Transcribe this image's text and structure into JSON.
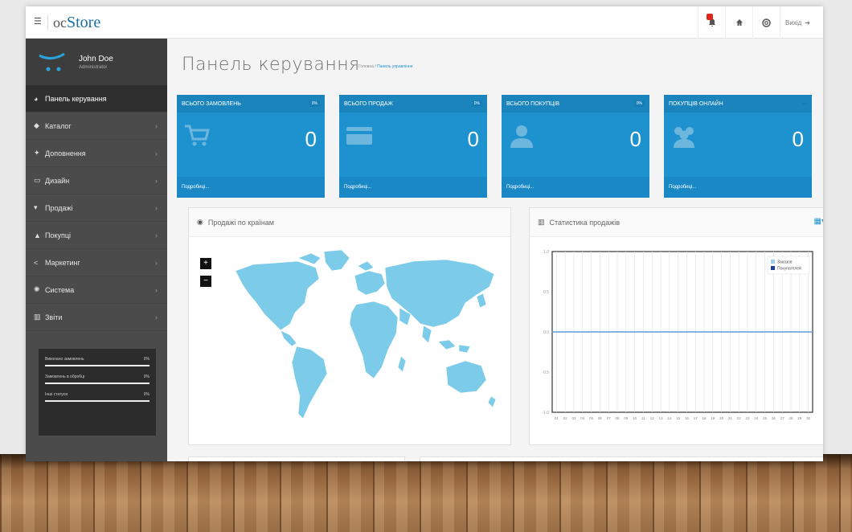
{
  "header": {
    "logo_prefix": "oc",
    "logo_main": "Store",
    "logout": "Вихід"
  },
  "profile": {
    "name": "John Doe",
    "role": "Administrator"
  },
  "sidebar": {
    "items": [
      {
        "label": "Панель керування",
        "icon": "dashboard-icon"
      },
      {
        "label": "Каталог",
        "icon": "tag-icon"
      },
      {
        "label": "Доповнення",
        "icon": "puzzle-icon"
      },
      {
        "label": "Дизайн",
        "icon": "monitor-icon"
      },
      {
        "label": "Продажі",
        "icon": "cart-icon"
      },
      {
        "label": "Покупці",
        "icon": "user-icon"
      },
      {
        "label": "Маркетинг",
        "icon": "share-icon"
      },
      {
        "label": "Система",
        "icon": "gear-icon"
      },
      {
        "label": "Звіти",
        "icon": "bar-chart-icon"
      }
    ],
    "progress": [
      {
        "label": "Виконано замовлень",
        "value": "0%"
      },
      {
        "label": "Замовлень в обробці",
        "value": "0%"
      },
      {
        "label": "Інші статуси",
        "value": "0%"
      }
    ]
  },
  "page": {
    "title": "Панель керування",
    "crumb_home": "Головна",
    "crumb_sep": " / ",
    "crumb_current": "Панель управління"
  },
  "tiles": [
    {
      "title": "ВСЬОГО ЗАМОВЛЕНЬ",
      "pct": "0%",
      "value": "0",
      "link": "Подробиці...",
      "icon": "cart-icon"
    },
    {
      "title": "ВСЬОГО ПРОДАЖ",
      "pct": "0%",
      "value": "0",
      "link": "Подробиці...",
      "icon": "credit-card-icon"
    },
    {
      "title": "ВСЬОГО ПОКУПЦІВ",
      "pct": "0%",
      "value": "0",
      "link": "Подробиці...",
      "icon": "user-icon"
    },
    {
      "title": "ПОКУПЦІВ ОНЛАЙН",
      "pct": "",
      "value": "0",
      "link": "Подробиці...",
      "icon": "users-icon"
    }
  ],
  "map_panel": {
    "title": "Продажі по країнам"
  },
  "chart_panel": {
    "title": "Статистика продажів"
  },
  "chart_data": {
    "type": "line",
    "x": [
      "01",
      "02",
      "03",
      "04",
      "05",
      "06",
      "07",
      "08",
      "09",
      "10",
      "11",
      "12",
      "13",
      "14",
      "15",
      "16",
      "17",
      "18",
      "19",
      "20",
      "21",
      "22",
      "23",
      "24",
      "25",
      "26",
      "27",
      "28",
      "29",
      "30"
    ],
    "series": [
      {
        "name": "Заказов",
        "color": "#9fcdee",
        "values": [
          0,
          0,
          0,
          0,
          0,
          0,
          0,
          0,
          0,
          0,
          0,
          0,
          0,
          0,
          0,
          0,
          0,
          0,
          0,
          0,
          0,
          0,
          0,
          0,
          0,
          0,
          0,
          0,
          0,
          0
        ]
      },
      {
        "name": "Покупателей",
        "color": "#1d3f9a",
        "values": [
          0,
          0,
          0,
          0,
          0,
          0,
          0,
          0,
          0,
          0,
          0,
          0,
          0,
          0,
          0,
          0,
          0,
          0,
          0,
          0,
          0,
          0,
          0,
          0,
          0,
          0,
          0,
          0,
          0,
          0
        ]
      }
    ],
    "yticks": [
      "1.0",
      "0.5",
      "0.0",
      "-0.5",
      "-1.0"
    ],
    "ylim": [
      -1,
      1
    ],
    "legend": "top-right",
    "grid": true
  },
  "colors": {
    "accent": "#1e91cf",
    "sidebar": "#4b4b4b",
    "map": "#7ccbe9"
  }
}
